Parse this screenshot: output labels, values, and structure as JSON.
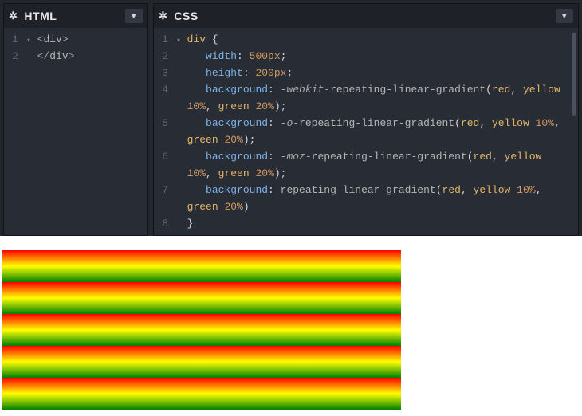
{
  "panels": {
    "html": {
      "title": "HTML"
    },
    "css": {
      "title": "CSS"
    }
  },
  "html_code": {
    "lines": [
      "1",
      "2"
    ],
    "l1_open_angle": "<",
    "l1_tag": "div",
    "l1_close_angle": ">",
    "l2_open_angle": "</",
    "l2_tag": "div",
    "l2_close_angle": ">"
  },
  "css_code": {
    "l1": {
      "n": "1",
      "sel": "div",
      "brace": " {"
    },
    "l2": {
      "n": "2",
      "prop": "width",
      "colon": ": ",
      "val": "500px",
      "semi": ";"
    },
    "l3": {
      "n": "3",
      "prop": "height",
      "colon": ": ",
      "val": "200px",
      "semi": ";"
    },
    "l4": {
      "n": "4",
      "prop": "background",
      "colon": ": ",
      "pfx": "-webkit-",
      "fn": "repeating-linear-gradient",
      "open": "(",
      "a1": "red",
      "c1": ", ",
      "a2": "yellow",
      "sp2": " ",
      "p2": "10%",
      "c2": ", ",
      "a3": "green",
      "sp3": " ",
      "p3": "20%",
      "close": ")",
      "semi": ";"
    },
    "l5": {
      "n": "5",
      "prop": "background",
      "colon": ": ",
      "pfx": "-o-",
      "fn": "repeating-linear-gradient",
      "open": "(",
      "a1": "red",
      "c1": ", ",
      "a2": "yellow",
      "sp2": " ",
      "p2": "10%",
      "c2": ", ",
      "a3": "green",
      "sp3": " ",
      "p3": "20%",
      "close": ")",
      "semi": ";"
    },
    "l6": {
      "n": "6",
      "prop": "background",
      "colon": ": ",
      "pfx": "-moz-",
      "fn": "repeating-linear-gradient",
      "open": "(",
      "a1": "red",
      "c1": ", ",
      "a2": "yellow",
      "sp2": " ",
      "p2": "10%",
      "c2": ", ",
      "a3": "green",
      "sp3": " ",
      "p3": "20%",
      "close": ")",
      "semi": ";"
    },
    "l7": {
      "n": "7",
      "prop": "background",
      "colon": ": ",
      "fn": "repeating-linear-gradient",
      "open": "(",
      "a1": "red",
      "c1": ", ",
      "a2": "yellow",
      "sp2": " ",
      "p2": "10%",
      "c2": ", ",
      "a3": "green",
      "sp3": " ",
      "p3": "20%",
      "close": ")"
    },
    "l8": {
      "n": "8",
      "brace": "}"
    }
  }
}
